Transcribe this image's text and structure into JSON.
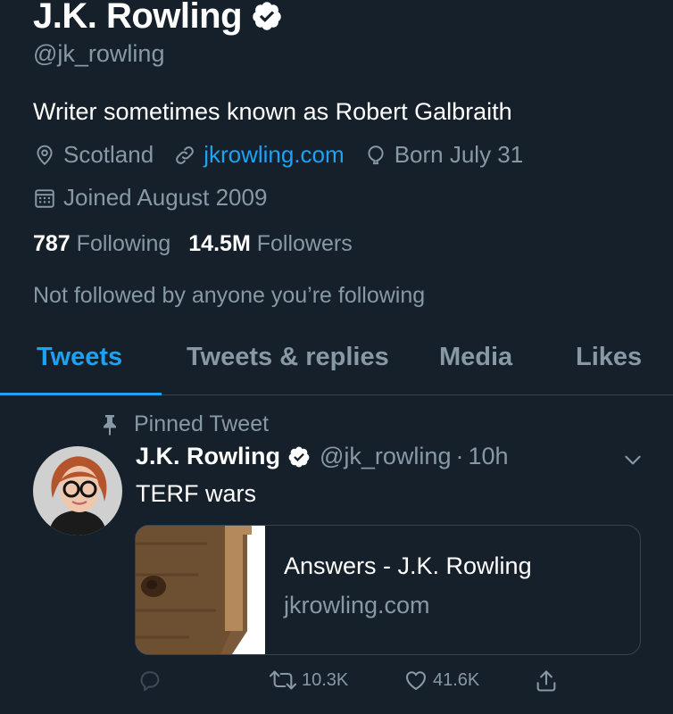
{
  "profile": {
    "name": "J.K. Rowling",
    "handle": "@jk_rowling",
    "bio": "Writer sometimes known as Robert Galbraith",
    "location": "Scotland",
    "website": "jkrowling.com",
    "birthday": "Born July 31",
    "joined": "Joined August 2009",
    "following_count": "787",
    "following_label": "Following",
    "followers_count": "14.5M",
    "followers_label": "Followers",
    "not_followed_text": "Not followed by anyone you’re following"
  },
  "tabs": [
    {
      "label": "Tweets",
      "active": true
    },
    {
      "label": "Tweets & replies",
      "active": false
    },
    {
      "label": "Media",
      "active": false
    },
    {
      "label": "Likes",
      "active": false
    }
  ],
  "tweet": {
    "pinned_label": "Pinned Tweet",
    "author_name": "J.K. Rowling",
    "author_handle": "@jk_rowling",
    "separator": "·",
    "time": "10h",
    "text": "TERF wars",
    "card": {
      "title": "Answers - J.K. Rowling",
      "domain": "jkrowling.com"
    },
    "retweets": "10.3K",
    "likes": "41.6K"
  },
  "colors": {
    "background": "#15202b",
    "accent": "#1da1f2",
    "secondary_text": "#8899a6",
    "divider": "#38444d"
  },
  "icons": {
    "verified": "verified-badge-icon",
    "location": "location-pin-icon",
    "link": "link-icon",
    "birthday": "balloon-icon",
    "joined": "calendar-icon",
    "pin": "pin-icon",
    "chevron": "chevron-down-icon",
    "reply": "reply-icon",
    "retweet": "retweet-icon",
    "like": "heart-icon",
    "share": "share-icon"
  }
}
